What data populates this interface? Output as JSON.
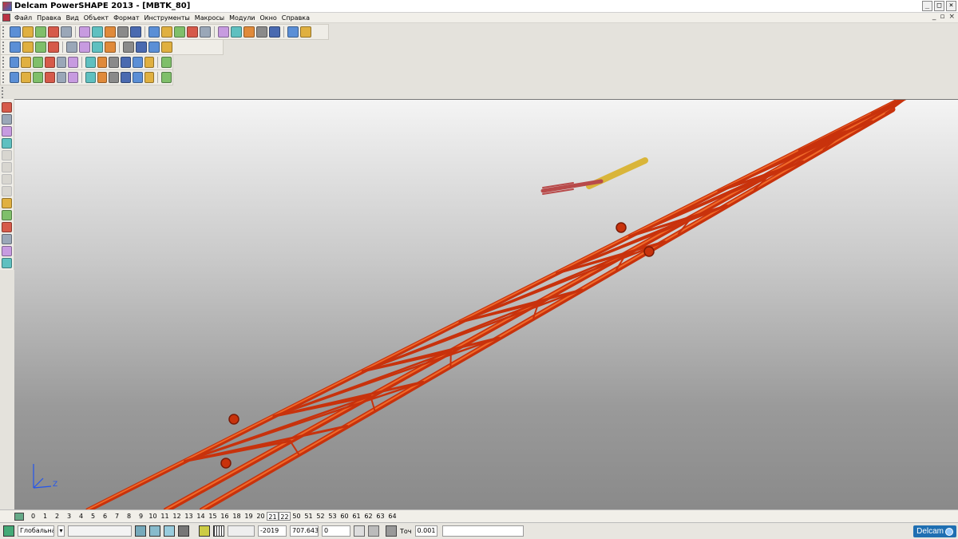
{
  "window": {
    "title": "Delcam PowerSHAPE 2013 - [MBTK_80]",
    "minimize": "_",
    "maximize": "□",
    "close": "×"
  },
  "menu": [
    "Файл",
    "Правка",
    "Вид",
    "Объект",
    "Формат",
    "Инструменты",
    "Макросы",
    "Модули",
    "Окно",
    "Справка"
  ],
  "mdi_controls": [
    "_",
    "▫",
    "×"
  ],
  "layers": {
    "numbers": [
      "0",
      "1",
      "2",
      "3",
      "4",
      "5",
      "6",
      "7",
      "8",
      "9",
      "10",
      "11",
      "12",
      "13",
      "14",
      "15",
      "16",
      "18",
      "19",
      "20",
      "21",
      "22",
      "50",
      "51",
      "52",
      "53",
      "60",
      "61",
      "62",
      "63",
      "64"
    ],
    "active": [
      "21",
      "22"
    ]
  },
  "status": {
    "workplane": "Глобальна",
    "coord_x": "-2019",
    "coord_y": "707.643",
    "coord_z": "0",
    "tolerance_label": "Точ",
    "tolerance_value": "0.001",
    "brand": "Delcam"
  },
  "axes": {
    "z_label": "Z"
  },
  "colors": {
    "model_red": "#c8320c",
    "model_highlight": "#f06a2a",
    "joint_yellow": "#d9b53a"
  },
  "icons": {
    "toolbar1": [
      "new-icon",
      "open-icon",
      "save-icon",
      "save-all-icon",
      "print-icon",
      "cut-icon",
      "copy-icon",
      "paste-icon",
      "delete-icon",
      "undo-icon",
      "redo-icon",
      "select-icon",
      "workplane-icon",
      "point-icon",
      "line-icon",
      "arc-icon",
      "curve-icon",
      "text-icon",
      "surface-icon",
      "solid-icon",
      "mesh-icon",
      "tools-icon"
    ],
    "toolbar2": [
      "view-top-icon",
      "view-front-icon",
      "view-iso-icon",
      "zoom-in-icon",
      "zoom-out-icon",
      "zoom-fit-icon",
      "pan-icon",
      "rotate-icon",
      "shade-icon",
      "wireframe-icon",
      "render-icon",
      "lights-icon"
    ],
    "toolbar3": [
      "block-icon",
      "cylinder-icon",
      "sphere-icon",
      "cone-icon",
      "torus-icon",
      "extrusion-icon",
      "revolution-icon",
      "box-icon",
      "fillet-icon",
      "chamfer-icon",
      "boolean-icon",
      "shell-icon",
      "split-icon"
    ],
    "toolbar4": [
      "pipe-icon",
      "transform-icon",
      "mirror-icon",
      "offset-icon",
      "scale-icon",
      "array-icon",
      "align-icon",
      "move-icon",
      "copy-feature-icon",
      "group-icon",
      "ungroup-icon",
      "measure-icon",
      "analysis-icon"
    ]
  }
}
